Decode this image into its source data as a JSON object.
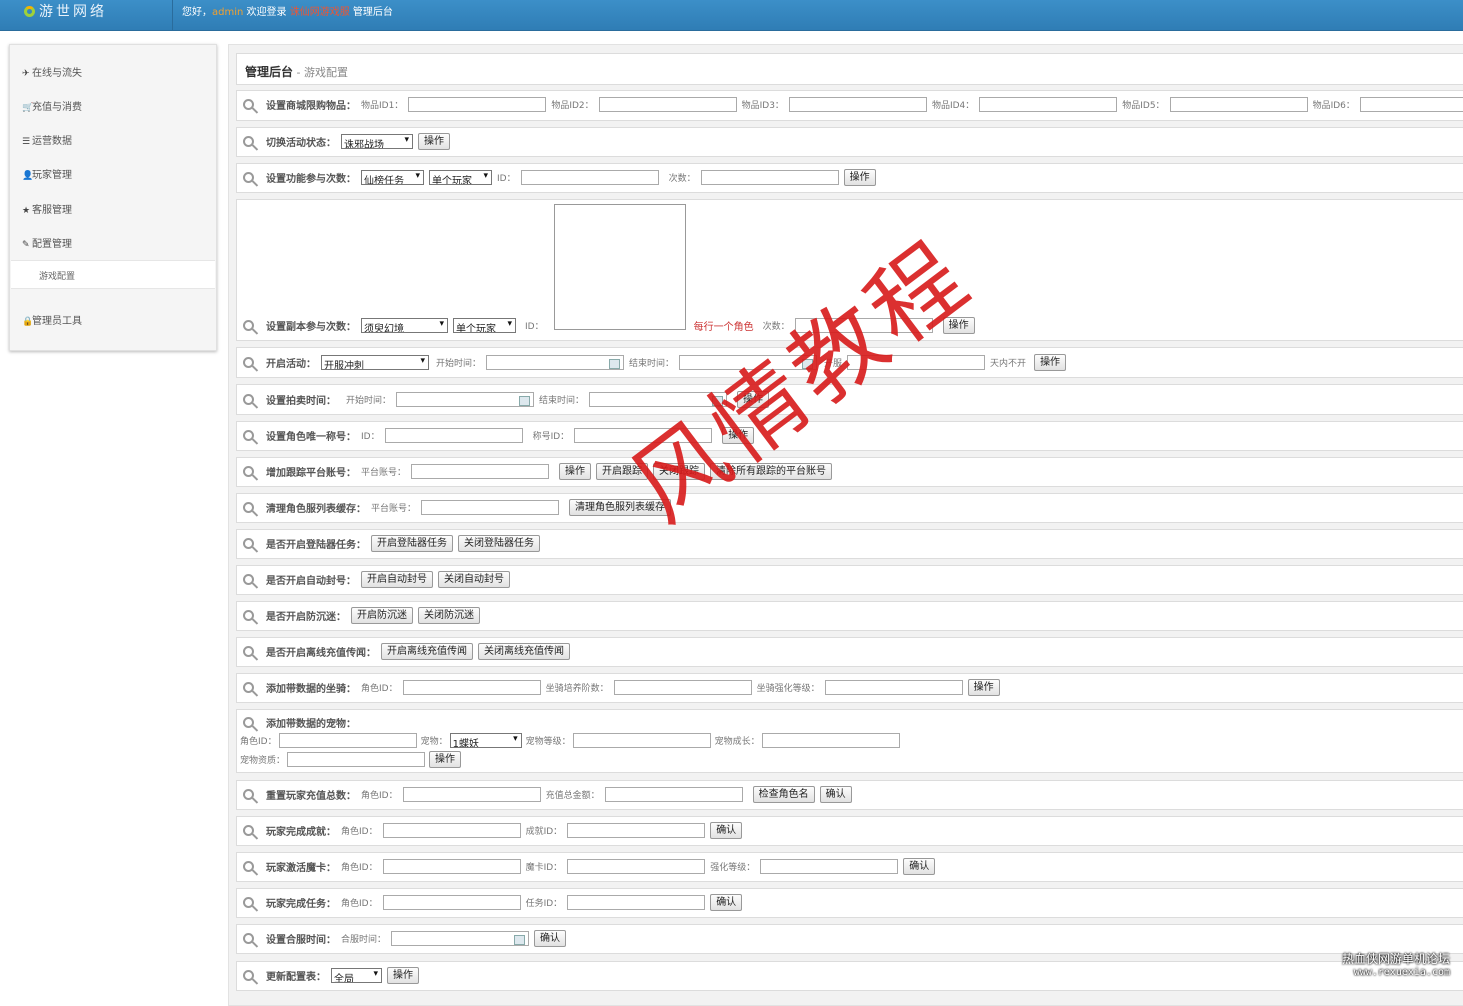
{
  "header": {
    "logo_text": "游世网络",
    "welcome_prefix": "您好，",
    "username": "admin",
    "welcome_mid": " 欢迎登录 ",
    "site_name": "诛仙网游戏服",
    "welcome_suffix": " 管理后台"
  },
  "sidebar": {
    "items": [
      {
        "icon": "plane-icon",
        "label": "在线与流失"
      },
      {
        "icon": "cart-icon",
        "label": "充值与消费"
      },
      {
        "icon": "list-icon",
        "label": "运营数据"
      },
      {
        "icon": "user-icon",
        "label": "玩家管理"
      },
      {
        "icon": "star-icon",
        "label": "客服管理"
      },
      {
        "icon": "edit-icon",
        "label": "配置管理"
      },
      {
        "icon": "lock-icon",
        "label": "管理员工具"
      }
    ],
    "sub_item": "游戏配置"
  },
  "breadcrumb": {
    "root": "管理后台",
    "sep": " - ",
    "current": "游戏配置"
  },
  "rows": {
    "mall_limit": {
      "label": "设置商城限购物品：",
      "f1": "物品ID1：",
      "f2": "物品ID2：",
      "f3": "物品ID3：",
      "f4": "物品ID4：",
      "f5": "物品ID5：",
      "f6": "物品ID6："
    },
    "activity_switch": {
      "label": "切换活动状态：",
      "select": "诛邪战场",
      "btn": "操作"
    },
    "func_times": {
      "label": "设置功能参与次数：",
      "select1": "仙榜任务",
      "select2": "单个玩家",
      "f1": "ID：",
      "f2": "次数：",
      "btn": "操作"
    },
    "dungeon_times": {
      "label": "设置副本参与次数：",
      "select1": "须臾幻境",
      "select2": "单个玩家",
      "f1": "ID：",
      "note": "每行一个角色",
      "f2": "次数：",
      "btn": "操作"
    },
    "open_activity": {
      "label": "开启活动：",
      "select": "开服冲刺",
      "start": "开始时间：",
      "end": "结束时间：",
      "kf": "开服",
      "days": "天内不开",
      "btn": "操作"
    },
    "auction_time": {
      "label": "设置拍卖时间：",
      "start": "开始时间：",
      "end": "结束时间：",
      "btn": "操作"
    },
    "unique_title": {
      "label": "设置角色唯一称号：",
      "f1": "ID：",
      "f2": "称号ID：",
      "btn": "操作"
    },
    "track_account": {
      "label": "增加跟踪平台账号：",
      "f1": "平台账号：",
      "b1": "操作",
      "b2": "开启跟踪",
      "b3": "关闭跟踪",
      "b4": "清除所有跟踪的平台账号"
    },
    "clear_cache": {
      "label": "清理角色服列表缓存：",
      "f1": "平台账号：",
      "btn": "清理角色服列表缓存"
    },
    "login_task": {
      "label": "是否开启登陆器任务：",
      "b1": "开启登陆器任务",
      "b2": "关闭登陆器任务"
    },
    "auto_ban": {
      "label": "是否开启自动封号：",
      "b1": "开启自动封号",
      "b2": "关闭自动封号"
    },
    "anti_addict": {
      "label": "是否开启防沉迷：",
      "b1": "开启防沉迷",
      "b2": "关闭防沉迷"
    },
    "offline_pay": {
      "label": "是否开启离线充值传闻：",
      "b1": "开启离线充值传闻",
      "b2": "关闭离线充值传闻"
    },
    "add_mount": {
      "label": "添加带数据的坐骑：",
      "f1": "角色ID：",
      "f2": "坐骑培养阶数：",
      "f3": "坐骑强化等级：",
      "btn": "操作"
    },
    "add_pet": {
      "label": "添加带数据的宠物：",
      "f1": "角色ID：",
      "f2": "宠物：",
      "select": "1蝶妖",
      "f3": "宠物等级：",
      "f4": "宠物成长：",
      "f5": "宠物资质：",
      "btn": "操作"
    },
    "reset_recharge": {
      "label": "重置玩家充值总数：",
      "f1": "角色ID：",
      "f2": "充值总金额：",
      "b1": "检查角色名",
      "b2": "确认"
    },
    "achievement": {
      "label": "玩家完成成就：",
      "f1": "角色ID：",
      "f2": "成就ID：",
      "btn": "确认"
    },
    "magic_card": {
      "label": "玩家激活魔卡：",
      "f1": "角色ID：",
      "f2": "魔卡ID：",
      "f3": "强化等级：",
      "btn": "确认"
    },
    "finish_task": {
      "label": "玩家完成任务：",
      "f1": "角色ID：",
      "f2": "任务ID：",
      "btn": "确认"
    },
    "merge_time": {
      "label": "设置合服时间：",
      "f1": "合服时间：",
      "btn": "确认"
    },
    "update_config": {
      "label": "更新配置表：",
      "select": "全局",
      "btn": "操作"
    }
  },
  "watermark": "风情教程",
  "credit": {
    "line1": "热血侠网游单机论坛",
    "line2": "www.rexuexia.com"
  }
}
